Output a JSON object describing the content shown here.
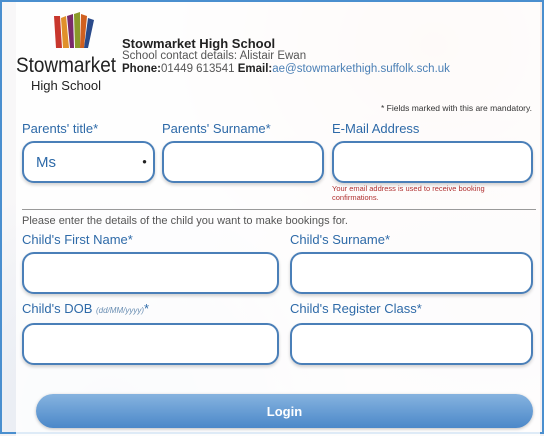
{
  "header": {
    "logo_word": "Stowmarket",
    "logo_sub": "High School",
    "school_name": "Stowmarket High School",
    "contact": "School contact details: Alistair Ewan",
    "phone_label": "Phone:",
    "phone": "01449 613541",
    "email_label": "Email:",
    "email": "ae@stowmarkethigh.suffolk.sch.uk"
  },
  "form": {
    "mandatory_note": "* Fields marked with this are mandatory.",
    "parent_title_label": "Parents' title*",
    "parent_title_value": "Ms",
    "parent_surname_label": "Parents' Surname*",
    "email_label": "E-Mail Address",
    "email_note": "Your email address is used to receive booking confirmations.",
    "instructions": "Please enter the details of the child you want to make bookings for.",
    "child_first_label": "Child's First Name*",
    "child_surname_label": "Child's Surname*",
    "child_dob_label": "Child's DOB",
    "child_dob_hint": "(dd/MM/yyyy)",
    "child_dob_star": "*",
    "child_class_label": "Child's Register Class*",
    "login_label": "Login"
  },
  "colors": {
    "accent": "#2e6aa8",
    "button": "#4b88c9",
    "error": "#b03030"
  }
}
